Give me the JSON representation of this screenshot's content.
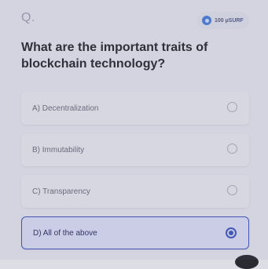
{
  "header": {
    "question_marker": "Q.",
    "reward_label": "100 µSURF"
  },
  "question": {
    "text": "What are the important traits of blockchain technology?"
  },
  "options": [
    {
      "label": "A) Decentralization",
      "selected": false
    },
    {
      "label": "B) Immutability",
      "selected": false
    },
    {
      "label": "C) Transparency",
      "selected": false
    },
    {
      "label": "D) All of the above",
      "selected": true
    }
  ],
  "colors": {
    "accent": "#3f56b8",
    "background": "#dcdde5",
    "question_text": "#2b2b33"
  },
  "icons": {
    "reward": "coin-icon",
    "radio": "radio-button"
  }
}
